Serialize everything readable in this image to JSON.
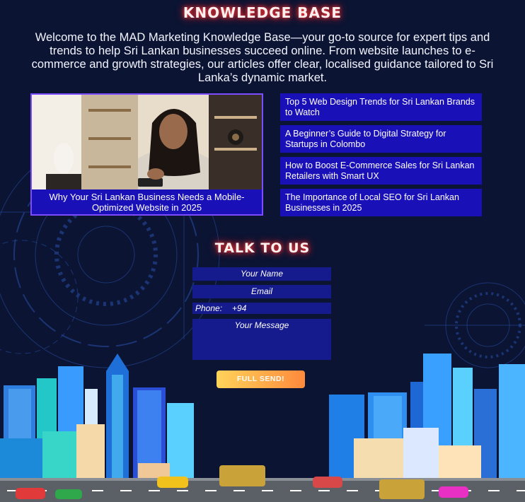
{
  "knowledge_base": {
    "title": "KNOWLEDGE BASE",
    "intro": "Welcome to the MAD Marketing Knowledge Base—your go-to source for expert tips and trends to help Sri Lankan businesses succeed online. From website launches to e-commerce and growth strategies, our articles offer clear, localised guidance tailored to Sri Lanka’s dynamic market.",
    "featured": {
      "caption": "Why Your Sri Lankan Business Needs a Mobile-Optimized Website in 2025"
    },
    "articles": [
      "Top 5 Web Design Trends for Sri Lankan Brands to Watch",
      "A Beginner’s Guide to Digital Strategy for Startups in Colombo",
      "How to Boost E-Commerce Sales for Sri Lankan Retailers with Smart UX",
      "The Importance of Local SEO for Sri Lankan Businesses in 2025"
    ]
  },
  "contact": {
    "title": "TALK TO US",
    "name_placeholder": "Your Name",
    "email_placeholder": "Email",
    "phone_label": "Phone:",
    "phone_code": "+94",
    "message_placeholder": "Your Message",
    "send_label": "FULL SEND!"
  },
  "colors": {
    "background": "#0b1433",
    "card": "#1a10b8",
    "featured_border": "#7b4dff",
    "field": "#151a8c",
    "glow": "#ff3b3b"
  }
}
